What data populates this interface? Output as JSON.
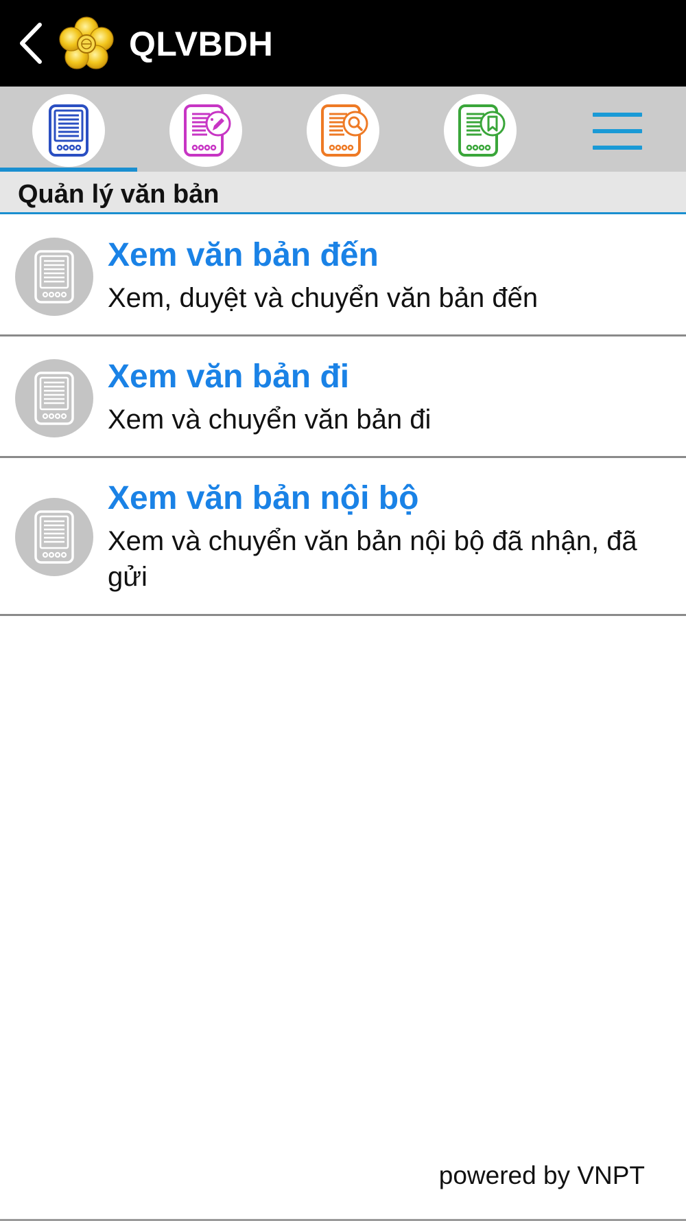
{
  "header": {
    "title": "QLVBDH",
    "back_icon": "chevron-left-icon",
    "logo_icon": "golden-flower-logo"
  },
  "tabs": [
    {
      "icon": "document-icon",
      "color": "#2a4fc2",
      "active": true
    },
    {
      "icon": "document-edit-icon",
      "color": "#c735c4",
      "active": false
    },
    {
      "icon": "document-search-icon",
      "color": "#ee7a25",
      "active": false
    },
    {
      "icon": "document-bookmark-icon",
      "color": "#3aa63a",
      "active": false
    }
  ],
  "menu_icon": "hamburger-menu-icon",
  "section": {
    "title": "Quản lý văn bản"
  },
  "items": [
    {
      "title": "Xem văn bản đến",
      "description": "Xem, duyệt và chuyển văn bản đến",
      "icon": "document-icon"
    },
    {
      "title": "Xem văn bản đi",
      "description": "Xem và chuyển văn bản đi",
      "icon": "document-icon"
    },
    {
      "title": "Xem văn bản nội bộ",
      "description": "Xem và chuyển văn bản nội bộ đã nhận, đã gửi",
      "icon": "document-icon"
    }
  ],
  "footer": {
    "text": "powered by VNPT"
  },
  "colors": {
    "accent": "#1a8fd0",
    "item_title": "#1a82e6",
    "topbar": "#000000",
    "tabbar": "#cbcbcb"
  }
}
